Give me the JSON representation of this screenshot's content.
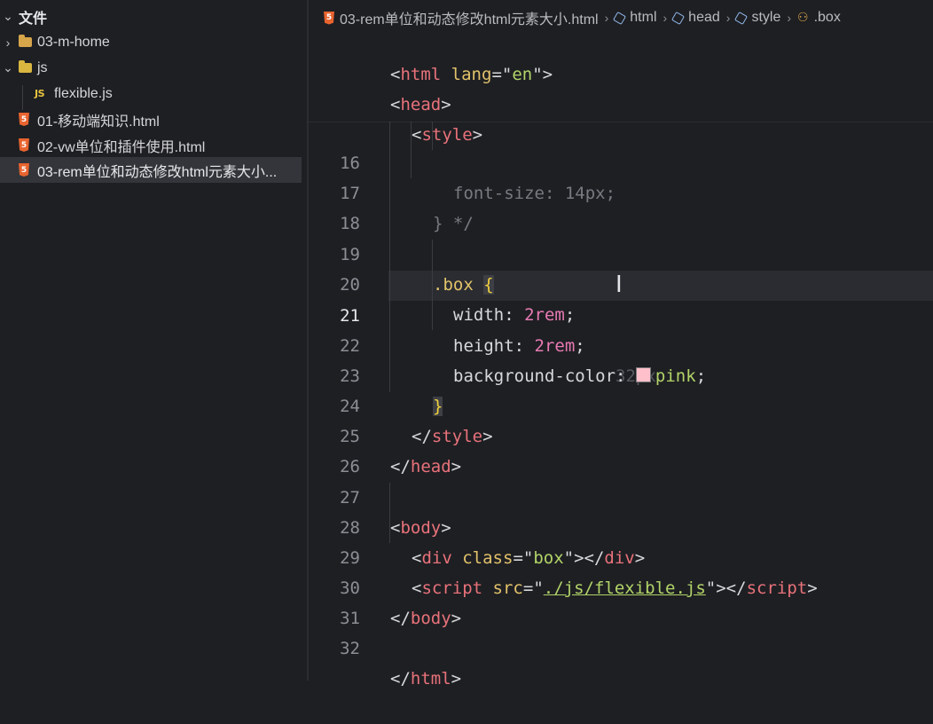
{
  "explorer": {
    "title": "文件",
    "items": [
      {
        "label": "03-m-home",
        "kind": "folder"
      },
      {
        "label": "js",
        "kind": "js-folder"
      },
      {
        "label": "flexible.js",
        "kind": "js-file",
        "badge": "JS"
      },
      {
        "label": "01-移动端知识.html",
        "kind": "html-file",
        "badge": "5"
      },
      {
        "label": "02-vw单位和插件使用.html",
        "kind": "html-file",
        "badge": "5"
      },
      {
        "label": "03-rem单位和动态修改html元素大小...",
        "kind": "html-file",
        "badge": "5"
      }
    ]
  },
  "breadcrumb": {
    "file": "03-rem单位和动态修改html元素大小.html",
    "file_badge": "5",
    "path": [
      "html",
      "head",
      "style",
      ".box"
    ]
  },
  "editor": {
    "sticky": [
      {
        "tag": "html",
        "attr": "lang",
        "value": "en"
      },
      {
        "tag": "head"
      },
      {
        "tag": "style"
      }
    ],
    "lines": [
      {
        "num": "16",
        "comment": "font-size: 14px;"
      },
      {
        "num": "17",
        "comment": "} */"
      },
      {
        "num": "18"
      },
      {
        "num": "19",
        "selector": ".box",
        "brace": "{"
      },
      {
        "num": "20",
        "prop": "width",
        "num_val": "2rem",
        "end": ";"
      },
      {
        "num": "21",
        "prop": "height",
        "num_val": "2rem",
        "end": ";",
        "hint": "32px"
      },
      {
        "num": "22",
        "prop": "background-color",
        "val": "pink",
        "end": ";"
      },
      {
        "num": "23",
        "brace": "}"
      },
      {
        "num": "24",
        "close_tag": "style"
      },
      {
        "num": "25",
        "close_tag": "head"
      },
      {
        "num": "26"
      },
      {
        "num": "27",
        "tag": "body"
      },
      {
        "num": "28",
        "tag": "div",
        "attr": "class",
        "value": "box",
        "close_tag": "div"
      },
      {
        "num": "29",
        "tag": "script",
        "attr": "src",
        "value": "./js/flexible.js",
        "close_tag": "script"
      },
      {
        "num": "30",
        "close_tag": "body"
      },
      {
        "num": "31"
      },
      {
        "num": "32",
        "close_tag": "html"
      }
    ],
    "current_line": "21",
    "swatch_color": "#ffc0cb"
  }
}
